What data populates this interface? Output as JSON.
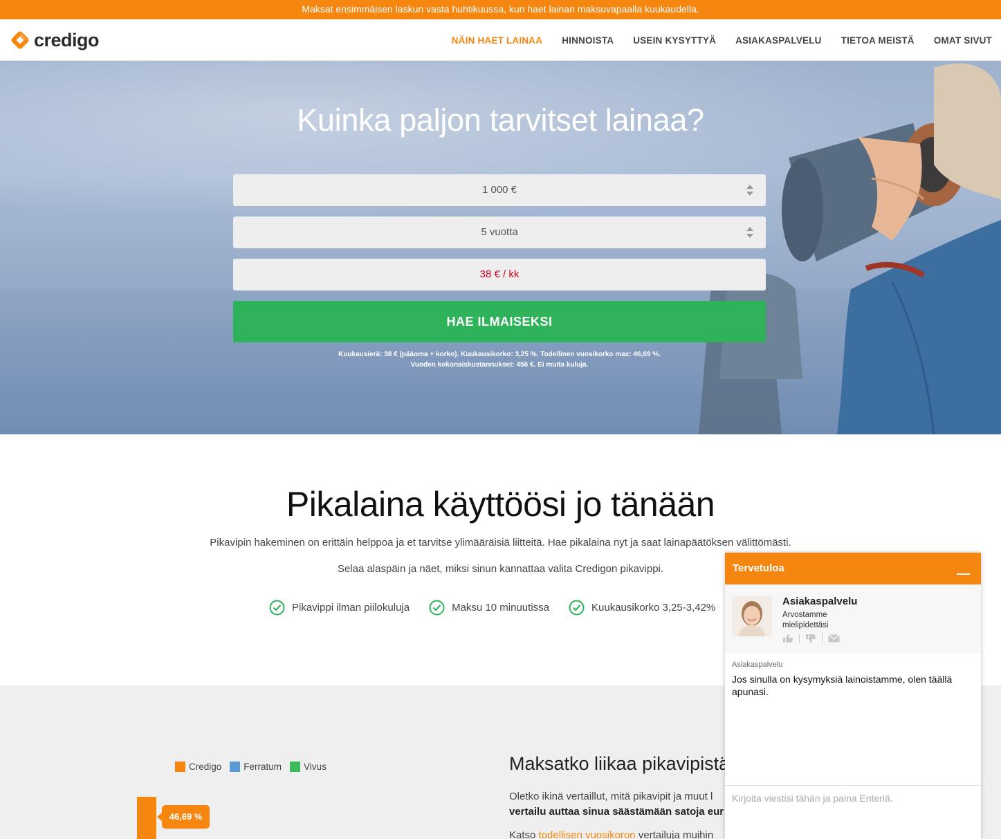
{
  "promo": {
    "text": "Maksat ensimmäisen laskun vasta huhtikuussa, kun haet lainan maksuvapaalla kuukaudella."
  },
  "header": {
    "logo_text": "credigo",
    "nav": [
      {
        "label": "NÄIN HAET LAINAA",
        "active": true
      },
      {
        "label": "HINNOISTA"
      },
      {
        "label": "USEIN KYSYTTYÄ"
      },
      {
        "label": "ASIAKASPALVELU"
      },
      {
        "label": "TIETOA MEISTÄ"
      },
      {
        "label": "OMAT SIVUT"
      }
    ]
  },
  "hero": {
    "title": "Kuinka paljon tarvitset lainaa?",
    "amount": "1 000 €",
    "term": "5 vuotta",
    "monthly": "38 € / kk",
    "apply_button": "HAE ILMAISEKSI",
    "fine_print_1": "Kuukausierä: 38 € (pääoma + korko). Kuukausikorko: 3,25 %. Todellinen vuosikorko max: 46,69 %.",
    "fine_print_2": "Vuoden kokonaiskustannukset: 456 €. Ei muita kuluja."
  },
  "intro": {
    "title": "Pikalaina käyttöösi jo tänään",
    "p1": "Pikavipin hakeminen on erittäin helppoa ja et tarvitse ylimääräisiä liitteitä. Hae pikalaina nyt ja saat lainapäätöksen välittömästi.",
    "p2": "Selaa alaspäin ja näet, miksi sinun kannattaa valita Credigon pikavippi.",
    "features": [
      "Pikavippi ilman piilokuluja",
      "Maksu 10 minuutissa",
      "Kuukausikorko 3,25-3,42%"
    ]
  },
  "compare": {
    "legend": [
      {
        "label": "Credigo",
        "color": "#f5860f"
      },
      {
        "label": "Ferratum",
        "color": "#5b9bd5"
      },
      {
        "label": "Vivus",
        "color": "#3cba5c"
      }
    ],
    "bar_label": "46,69 %",
    "title": "Maksatko liikaa pikavipistä?",
    "p_start": "Oletko ikinä vertaillut, mitä pikavipit ja muut l",
    "p_bold": "vertailu auttaa sinua säästämään satoja eur",
    "link_prefix": "Katso ",
    "link_text": "todellisen vuosikoron",
    "link_suffix": " vertailuja muihin"
  },
  "chat": {
    "header": "Tervetuloa",
    "agent_name": "Asiakaspalvelu",
    "agent_sub": "Arvostamme mielipidettäsi",
    "msg_sender": "Asiakaspalvelu",
    "msg_text": "Jos sinulla on kysymyksiä lainoistamme, olen täällä apunasi.",
    "input_placeholder": "Kirjoita viestisi tähän ja paina Enteriä."
  }
}
